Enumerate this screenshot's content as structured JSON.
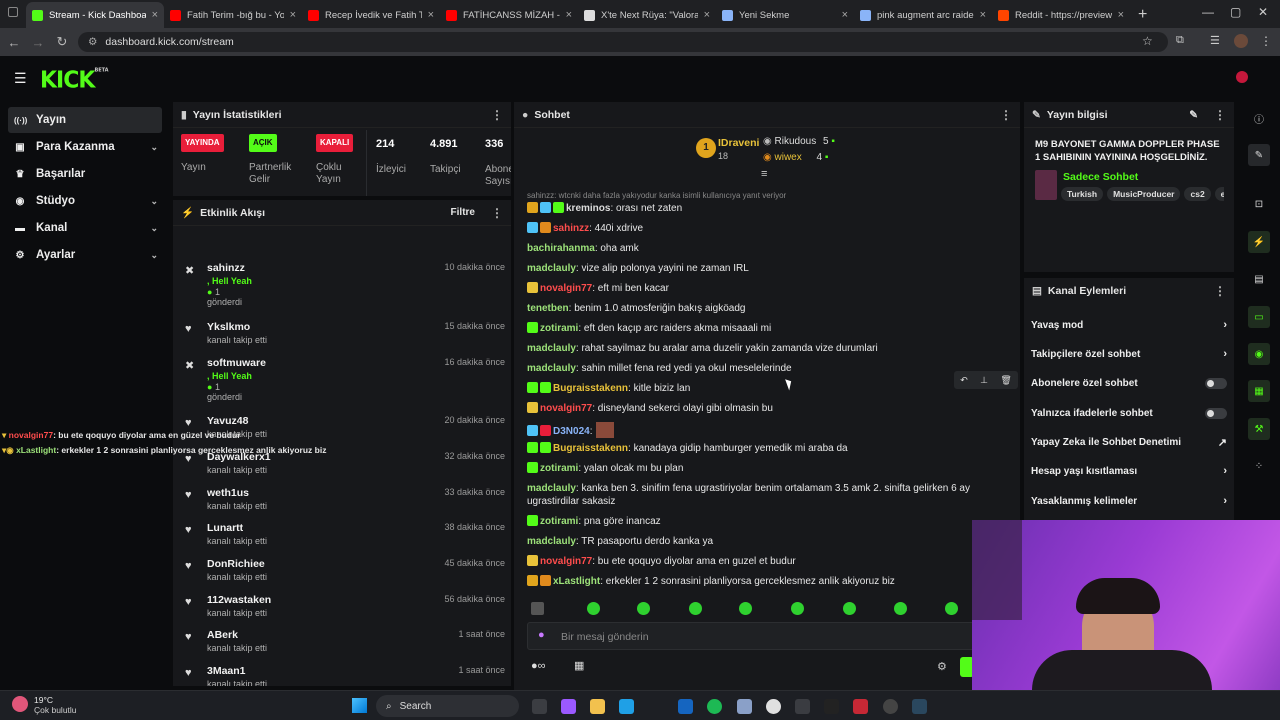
{
  "browser": {
    "tabs": [
      {
        "title": "Stream - Kick Dashboard",
        "color": "#53fc18"
      },
      {
        "title": "Fatih Terim -bığ bu - YouTube",
        "color": "#ff0000"
      },
      {
        "title": "Recep İvedik ve Fatih Terim",
        "color": "#ff0000"
      },
      {
        "title": "FATİHCANSS MİZAH - JET",
        "color": "#ff0000"
      },
      {
        "title": "X'te Next Rüya: \"Valorant",
        "color": "#dddddd"
      },
      {
        "title": "Yeni Sekme",
        "color": "#8ab4f8"
      },
      {
        "title": "pink augment arc raiders",
        "color": "#8ab4f8"
      },
      {
        "title": "Reddit - https://preview.red",
        "color": "#ff4500"
      }
    ],
    "url": "dashboard.kick.com/stream"
  },
  "nav": {
    "items": [
      {
        "label": "Yayın",
        "icon": "broadcast-icon"
      },
      {
        "label": "Para Kazanma",
        "icon": "money-icon"
      },
      {
        "label": "Başarılar",
        "icon": "trophy-icon"
      },
      {
        "label": "Stüdyo",
        "icon": "studio-icon"
      },
      {
        "label": "Kanal",
        "icon": "channel-icon"
      },
      {
        "label": "Ayarlar",
        "icon": "gear-icon"
      }
    ]
  },
  "stats": {
    "title": "Yayın İstatistikleri",
    "live_badge": "YAYINDA",
    "live_label": "Yayın",
    "partner_badge": "AÇIK",
    "partner_label": "Partnerlik Gelir Programı",
    "multi_badge": "KAPALI",
    "multi_label": "Çoklu Yayın",
    "viewers": "214",
    "viewers_label": "İzleyici",
    "followers": "4.891",
    "followers_label": "Takipçi",
    "subs": "336",
    "subs_label": "Abone Sayısı"
  },
  "activity": {
    "title": "Etkinlik Akışı",
    "filter": "Filtre",
    "items": [
      {
        "name": "sahinzz",
        "sub": ", Hell Yeah",
        "extra": "1",
        "sub2": "gönderdi",
        "time": "10 dakika önce",
        "kind": "kick"
      },
      {
        "name": "Ykslkmo",
        "sub": "kanalı takip etti",
        "time": "15 dakika önce",
        "kind": "follow"
      },
      {
        "name": "softmuware",
        "sub": ", Hell Yeah",
        "extra": "1",
        "sub2": "gönderdi",
        "time": "16 dakika önce",
        "kind": "kick"
      },
      {
        "name": "Yavuz48",
        "sub": "kanalı takip etti",
        "time": "20 dakika önce",
        "kind": "follow"
      },
      {
        "name": "Daywalkerx1",
        "sub": "kanalı takip etti",
        "time": "32 dakika önce",
        "kind": "follow"
      },
      {
        "name": "weth1us",
        "sub": "kanalı takip etti",
        "time": "33 dakika önce",
        "kind": "follow"
      },
      {
        "name": "Lunartt",
        "sub": "kanalı takip etti",
        "time": "38 dakika önce",
        "kind": "follow"
      },
      {
        "name": "DonRichiee",
        "sub": "kanalı takip etti",
        "time": "45 dakika önce",
        "kind": "follow"
      },
      {
        "name": "112wastaken",
        "sub": "kanalı takip etti",
        "time": "56 dakika önce",
        "kind": "follow"
      },
      {
        "name": "ABerk",
        "sub": "kanalı takip etti",
        "time": "1 saat önce",
        "kind": "follow"
      },
      {
        "name": "3Maan1",
        "sub": "kanalı takip etti",
        "time": "1 saat önce",
        "kind": "follow"
      }
    ]
  },
  "overlay_chat": [
    {
      "user": "novalgin77",
      "text": ": bu ete qoquyo diyolar ama en güzel ve budur"
    },
    {
      "user": "xLastlight",
      "text": ": erkekler 1 2 sonrasini planliyorsa gerceklesmez anlik akiyoruz biz"
    }
  ],
  "chat": {
    "title": "Sohbet",
    "top": [
      {
        "rank": "1",
        "name": "IDraveni",
        "count": "18"
      },
      {
        "name": "Rikudous",
        "count": "5"
      },
      {
        "name": "wiwex",
        "count": "4"
      }
    ],
    "reply_note": "sahinzz: wtcnki daha fazla yakıyodur kanka isimli kullanıcıya yanıt veriyor",
    "messages": [
      {
        "user": "kreminos",
        "color": "#dcdcdc",
        "text": ": orası net zaten"
      },
      {
        "user": "sahinzz",
        "color": "#ff4d4d",
        "text": ": 440i xdrive"
      },
      {
        "user": "bachirahanma",
        "color": "#9de27a",
        "text": ": oha amk"
      },
      {
        "user": "madclauly",
        "color": "#9de27a",
        "text": ": vize alip polonya yayini ne zaman IRL"
      },
      {
        "user": "novalgin77",
        "color": "#ff4d4d",
        "text": ": eft mi ben kacar"
      },
      {
        "user": "tenetben",
        "color": "#9de27a",
        "text": ": benim 1.0 atmosferiğin bakış aigköadg"
      },
      {
        "user": "zotirami",
        "color": "#9de27a",
        "text": ": eft den kaçıp arc raiders akma misaaali mi"
      },
      {
        "user": "madclauly",
        "color": "#9de27a",
        "text": ": rahat sayilmaz bu aralar ama duzelir yakin zamanda vize durumlari"
      },
      {
        "user": "madclauly",
        "color": "#9de27a",
        "text": ": sahin millet fena red yedi ya okul meselelerinde"
      },
      {
        "user": "Bugraisstakenn",
        "color": "#e8c23a",
        "text": ": kitle biziz lan"
      },
      {
        "user": "novalgin77",
        "color": "#ff4d4d",
        "text": ": disneyland sekerci olayi gibi olmasin bu"
      },
      {
        "user": "D3N024",
        "color": "#8ab4f8",
        "text": ":"
      },
      {
        "user": "Bugraisstakenn",
        "color": "#e8c23a",
        "text": ": kanadaya gidip hamburger yemedik mi araba da"
      },
      {
        "user": "zotirami",
        "color": "#9de27a",
        "text": ": yalan olcak mı bu plan"
      },
      {
        "user": "madclauly",
        "color": "#9de27a",
        "text": ": kanka ben 3. sinifim fena ugrastiriyolar benim ortalamam 3.5 amk 2. sinifta gelirken 6 ay ugrastirdilar sakasiz"
      },
      {
        "user": "zotirami",
        "color": "#9de27a",
        "text": ": pna göre inancaz"
      },
      {
        "user": "madclauly",
        "color": "#9de27a",
        "text": ": TR pasaportu derdo kanka ya"
      },
      {
        "user": "novalgin77",
        "color": "#ff4d4d",
        "text": ": bu ete qoquyo diyolar ama en guzel et budur"
      },
      {
        "user": "xLastlight",
        "color": "#9de27a",
        "text": ": erkekler 1 2 sonrasini planliyorsa gerceklesmez anlik akiyoruz biz"
      }
    ],
    "input_placeholder": "Bir mesaj gönderin"
  },
  "stream_info": {
    "title": "Yayın bilgisi",
    "heading": "M9 BAYONET GAMMA DOPPLER PHASE 1 SAHIBININ YAYININA HOŞGELDİNİZ.",
    "category": "Sadece Sohbet",
    "tags": [
      "Turkish",
      "MusicProducer",
      "cs2",
      "en"
    ]
  },
  "channel_actions": {
    "title": "Kanal Eylemleri",
    "items": [
      {
        "label": "Yavaş mod",
        "control": "chevron"
      },
      {
        "label": "Takipçilere özel sohbet",
        "control": "chevron"
      },
      {
        "label": "Abonelere özel sohbet",
        "control": "toggle"
      },
      {
        "label": "Yalnızca ifadelerle sohbet",
        "control": "toggle"
      },
      {
        "label": "Yapay Zeka ile Sohbet Denetimi",
        "control": "external"
      },
      {
        "label": "Hesap yaşı kısıtlaması",
        "control": "chevron"
      },
      {
        "label": "Yasaklanmış kelimeler",
        "control": "chevron"
      }
    ]
  },
  "taskbar": {
    "weather_temp": "19°C",
    "weather_desc": "Çok bulutlu",
    "search": "Search"
  },
  "colors": {
    "kick_green": "#53fc18",
    "bg": "#0b0c0e",
    "panel": "#17181b",
    "live_red": "#e91e3a"
  }
}
